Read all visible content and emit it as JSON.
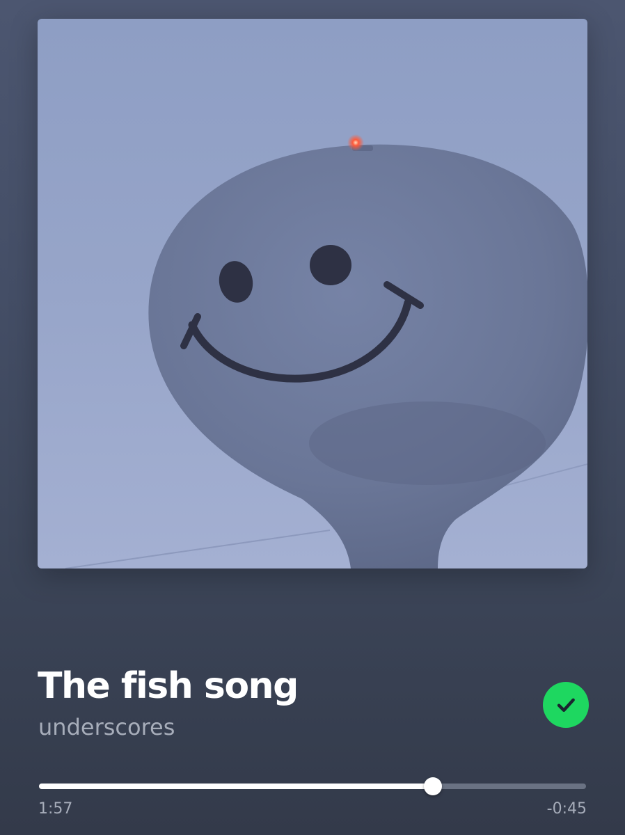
{
  "track": {
    "title": "The fish song",
    "artist": "underscores",
    "liked": true
  },
  "icons": {
    "liked": "check-circle-icon"
  },
  "colors": {
    "liked_badge": "#1ed760",
    "progress_fill": "#ffffff",
    "progress_track": "#6a7283"
  },
  "playback": {
    "elapsed": "1:57",
    "remaining": "-0:45",
    "progress": 0.72
  }
}
